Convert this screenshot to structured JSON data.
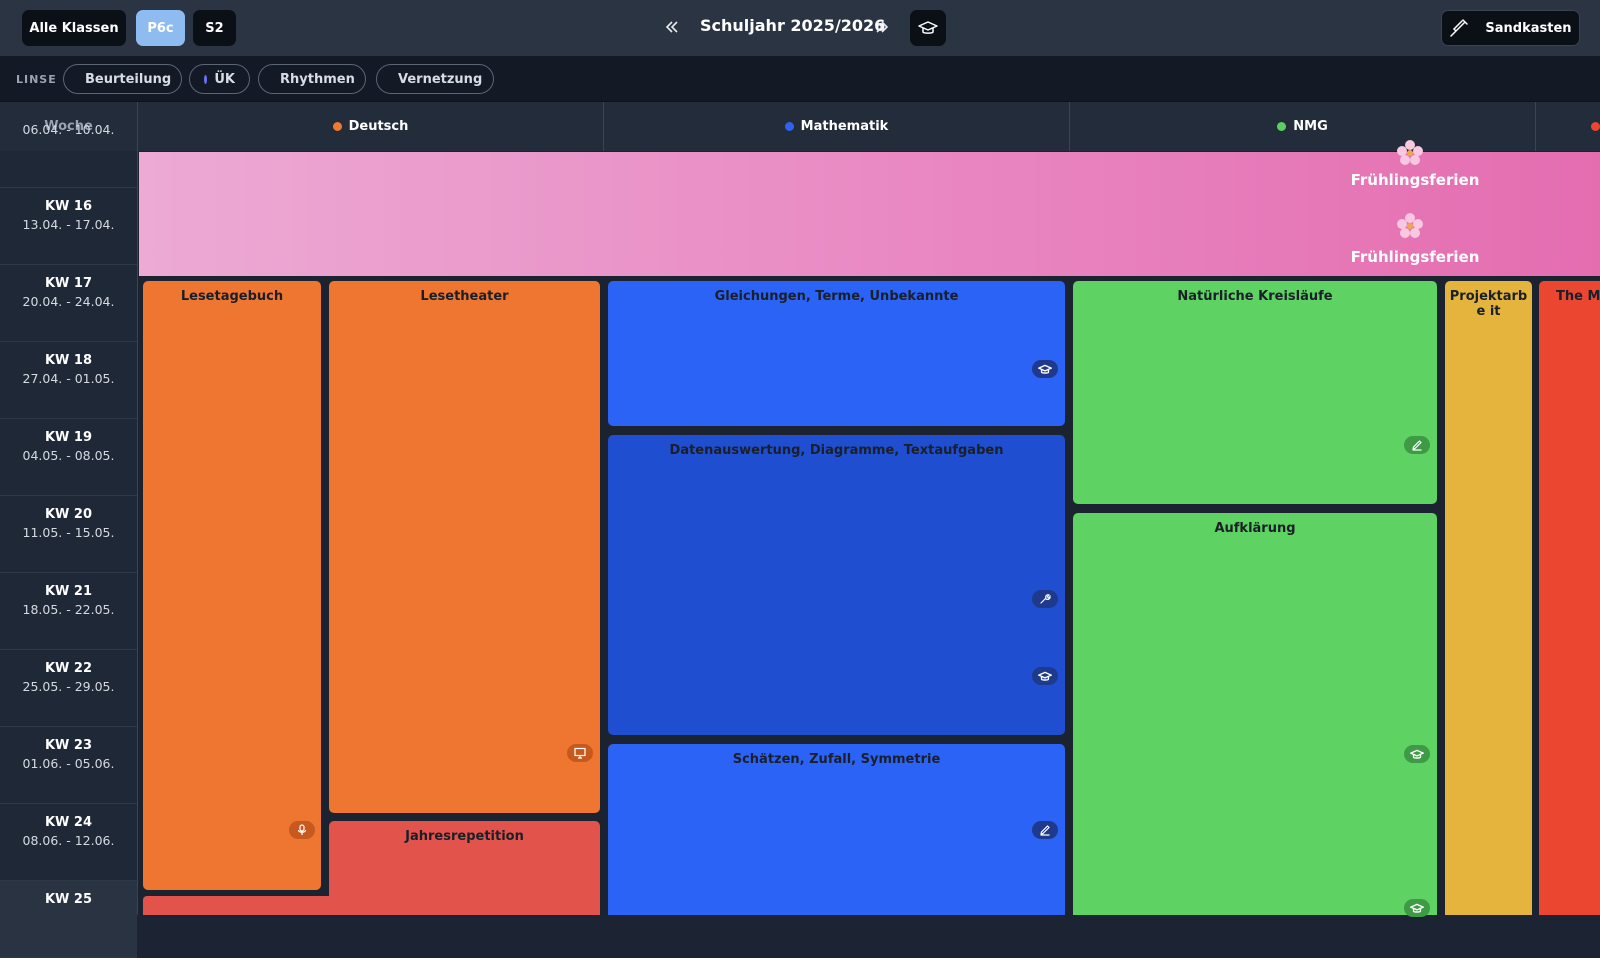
{
  "topbar": {
    "all_classes_label": "Alle Klassen",
    "class_label": "P6c",
    "semester_label": "S2",
    "prev_icon": "double-chevron-left-icon",
    "year_title": "Schuljahr 2025/2026",
    "next_icon": "double-chevron-right-icon",
    "graduation_icon": "graduation-cap-icon",
    "sandbox_label": "Sandkasten",
    "sandbox_icon": "syringe-icon"
  },
  "lens": {
    "label": "LINSE",
    "chips": [
      {
        "label": "Beurteilung",
        "color": "#e9b33b"
      },
      {
        "label": "ÜK",
        "color": "#6a6ff0"
      },
      {
        "label": "Rhythmen",
        "color": "#c563e6"
      },
      {
        "label": "Vernetzung",
        "color": "#4cc3d3"
      }
    ]
  },
  "columns": {
    "week_header": "Woche",
    "subjects": [
      {
        "label": "Deutsch",
        "color": "#f07a2e"
      },
      {
        "label": "Mathematik",
        "color": "#2e63f0"
      },
      {
        "label": "NMG",
        "color": "#5ad15f"
      }
    ]
  },
  "weeks": [
    {
      "kw": "",
      "dates": "06.04. - 10.04."
    },
    {
      "kw": "KW 16",
      "dates": "13.04. - 17.04."
    },
    {
      "kw": "KW 17",
      "dates": "20.04. - 24.04."
    },
    {
      "kw": "KW 18",
      "dates": "27.04. - 01.05."
    },
    {
      "kw": "KW 19",
      "dates": "04.05. - 08.05."
    },
    {
      "kw": "KW 20",
      "dates": "11.05. - 15.05."
    },
    {
      "kw": "KW 21",
      "dates": "18.05. - 22.05."
    },
    {
      "kw": "KW 22",
      "dates": "25.05. - 29.05."
    },
    {
      "kw": "KW 23",
      "dates": "01.06. - 05.06."
    },
    {
      "kw": "KW 24",
      "dates": "08.06. - 12.06."
    },
    {
      "kw": "KW 25",
      "dates": ""
    }
  ],
  "holiday": {
    "label_1": "Frühlingsferien",
    "label_2": "Frühlingsferien",
    "icon": "flower-icon",
    "color": "#e987c2"
  },
  "blocks": {
    "lesetagebuch": "Lesetagebuch",
    "lesetheater": "Lesetheater",
    "jahresrepetition": "Jahresrepetition",
    "gleichungen": "Gleichungen, Terme, Unbekannte",
    "datenauswertung": "Datenauswertung, Diagramme, Textaufgaben",
    "schaetzen": "Schätzen, Zufall, Symmetrie",
    "kreislaeufe": "Natürliche Kreisläufe",
    "aufklaerung": "Aufklärung",
    "projektarbeit": "Projektarbe it",
    "the_mo": "The Mo"
  },
  "colors": {
    "deutsch": "#ee7631",
    "jahresrepetition": "#e2534b",
    "math": "#2b63f6",
    "math_dark": "#1f4fd0",
    "nmg": "#5ed262",
    "projekt": "#e4b43d",
    "red": "#ea4630"
  }
}
